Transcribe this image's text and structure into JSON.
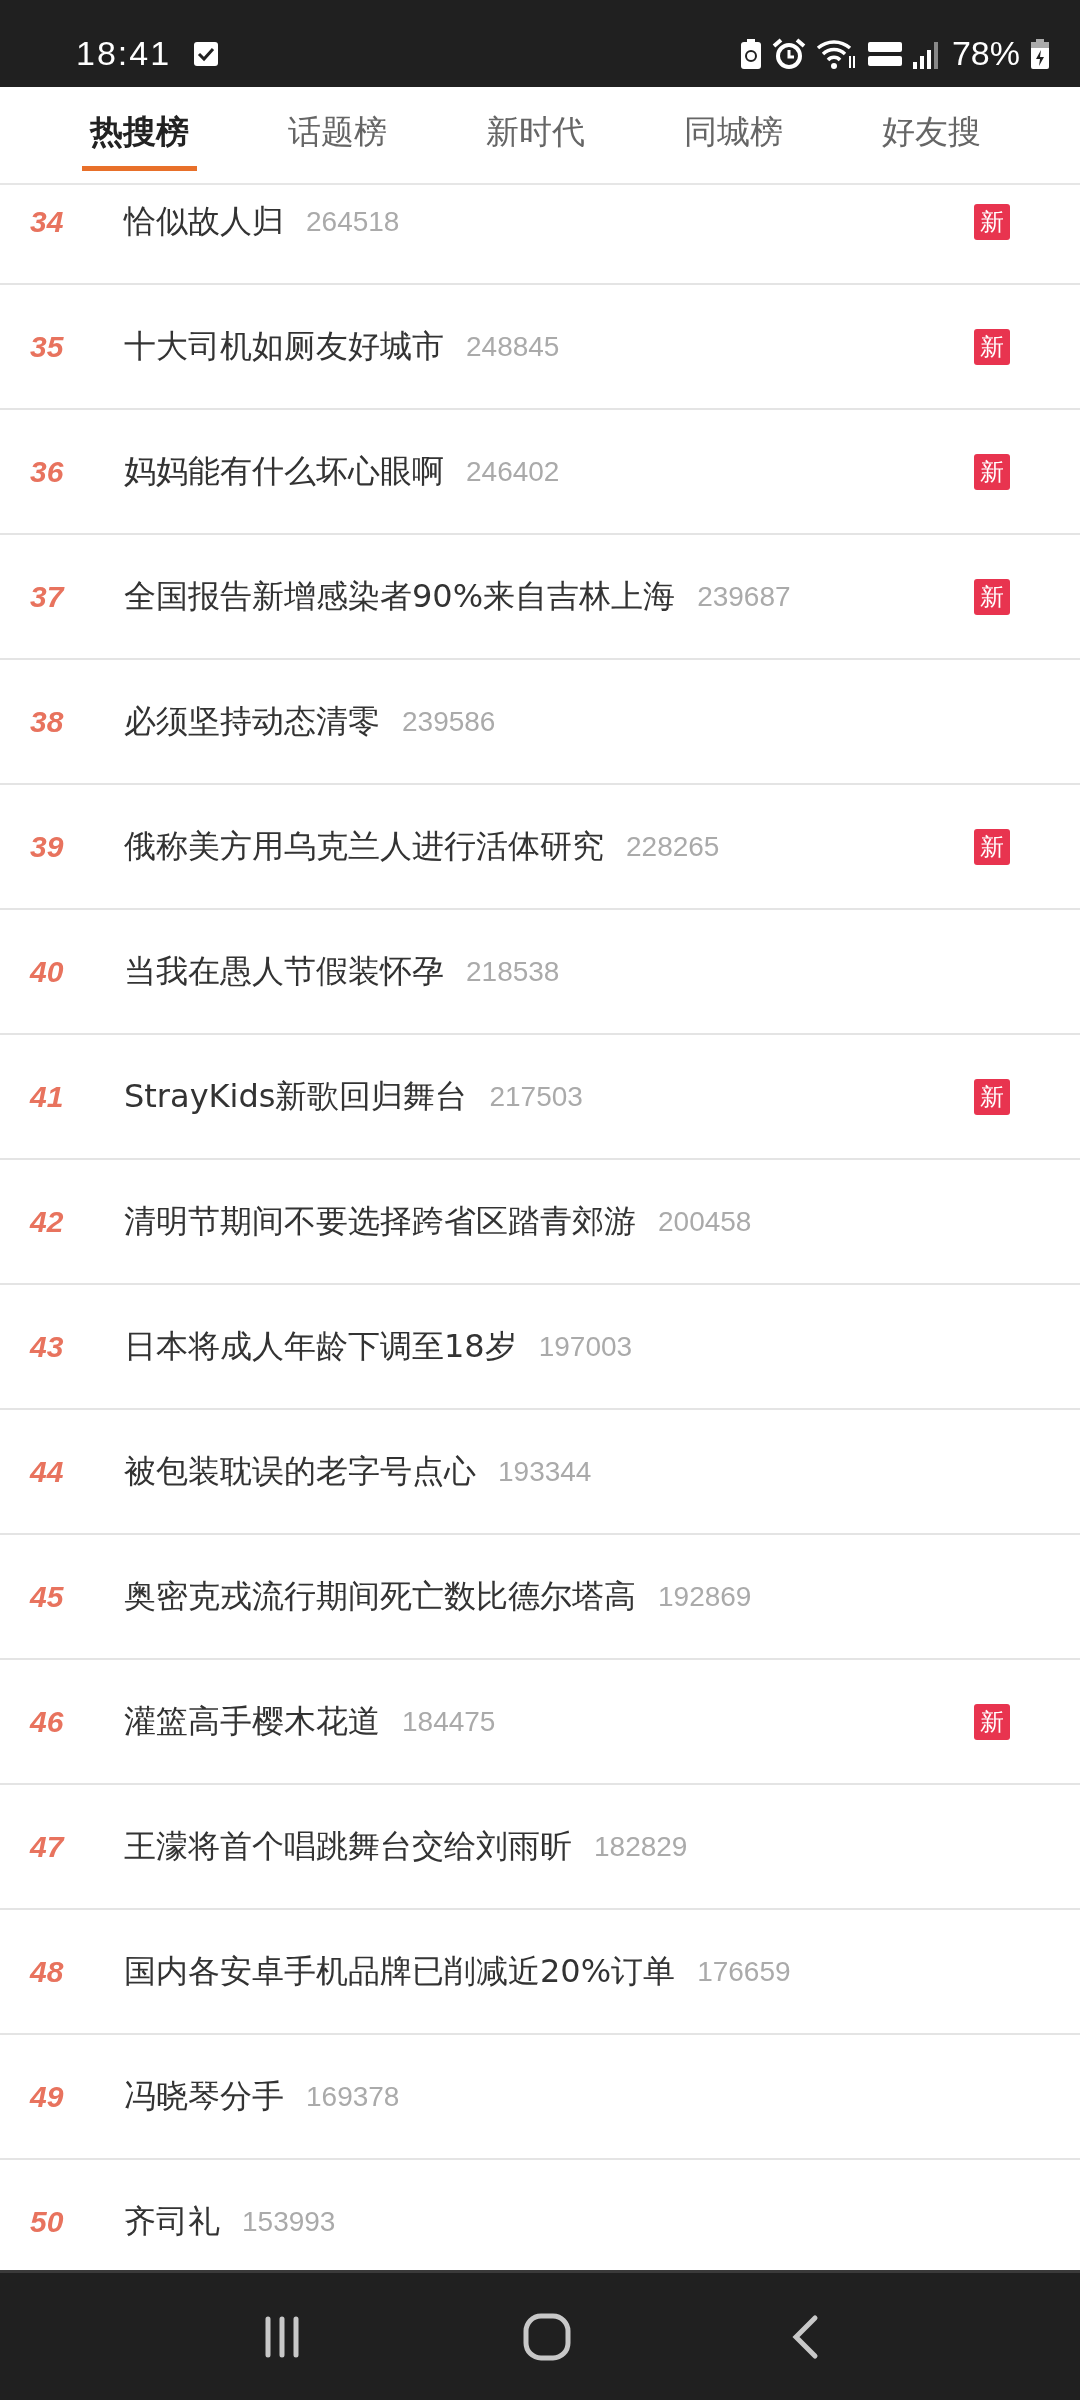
{
  "status_bar": {
    "time": "18:41",
    "battery": "78%"
  },
  "tabs": [
    {
      "label": "热搜榜",
      "selected": true
    },
    {
      "label": "话题榜",
      "selected": false
    },
    {
      "label": "新时代",
      "selected": false
    },
    {
      "label": "同城榜",
      "selected": false
    },
    {
      "label": "好友搜",
      "selected": false
    }
  ],
  "rows": [
    {
      "rank": "34",
      "title": "恰似故人归",
      "count": "264518",
      "badge": "新"
    },
    {
      "rank": "35",
      "title": "十大司机如厕友好城市",
      "count": "248845",
      "badge": "新"
    },
    {
      "rank": "36",
      "title": "妈妈能有什么坏心眼啊",
      "count": "246402",
      "badge": "新"
    },
    {
      "rank": "37",
      "title": "全国报告新增感染者90%来自吉林上海",
      "count": "239687",
      "badge": "新"
    },
    {
      "rank": "38",
      "title": "必须坚持动态清零",
      "count": "239586"
    },
    {
      "rank": "39",
      "title": "俄称美方用乌克兰人进行活体研究",
      "count": "228265",
      "badge": "新"
    },
    {
      "rank": "40",
      "title": "当我在愚人节假装怀孕",
      "count": "218538"
    },
    {
      "rank": "41",
      "title": "StrayKids新歌回归舞台",
      "count": "217503",
      "badge": "新"
    },
    {
      "rank": "42",
      "title": "清明节期间不要选择跨省区踏青郊游",
      "count": "200458"
    },
    {
      "rank": "43",
      "title": "日本将成人年龄下调至18岁",
      "count": "197003"
    },
    {
      "rank": "44",
      "title": "被包装耽误的老字号点心",
      "count": "193344"
    },
    {
      "rank": "45",
      "title": "奥密克戎流行期间死亡数比德尔塔高",
      "count": "192869"
    },
    {
      "rank": "46",
      "title": "灌篮高手樱木花道",
      "count": "184475",
      "badge": "新"
    },
    {
      "rank": "47",
      "title": "王濛将首个唱跳舞台交给刘雨昕",
      "count": "182829"
    },
    {
      "rank": "48",
      "title": "国内各安卓手机品牌已削减近20%订单",
      "count": "176659"
    },
    {
      "rank": "49",
      "title": "冯晓琴分手",
      "count": "169378"
    },
    {
      "rank": "50",
      "title": "齐司礼",
      "count": "153993"
    }
  ]
}
